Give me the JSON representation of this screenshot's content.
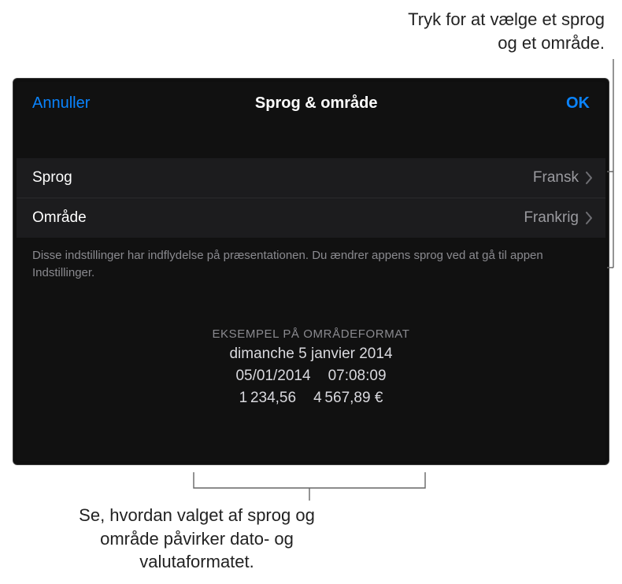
{
  "callouts": {
    "top": "Tryk for at vælge et sprog og et område.",
    "bottom": "Se, hvordan valget af sprog og område påvirker dato- og valutaformatet."
  },
  "nav": {
    "cancel": "Annuller",
    "title": "Sprog & område",
    "ok": "OK"
  },
  "rows": {
    "language": {
      "label": "Sprog",
      "value": "Fransk"
    },
    "region": {
      "label": "Område",
      "value": "Frankrig"
    }
  },
  "footer_note": "Disse indstillinger har indflydelse på præsentationen. Du ændrer appens sprog ved at gå til appen Indstillinger.",
  "example": {
    "heading": "EKSEMPEL PÅ OMRÅDEFORMAT",
    "long_date": "dimanche 5 janvier 2014",
    "short_date": "05/01/2014",
    "time": "07:08:09",
    "number": "1 234,56",
    "currency": "4 567,89 €"
  }
}
